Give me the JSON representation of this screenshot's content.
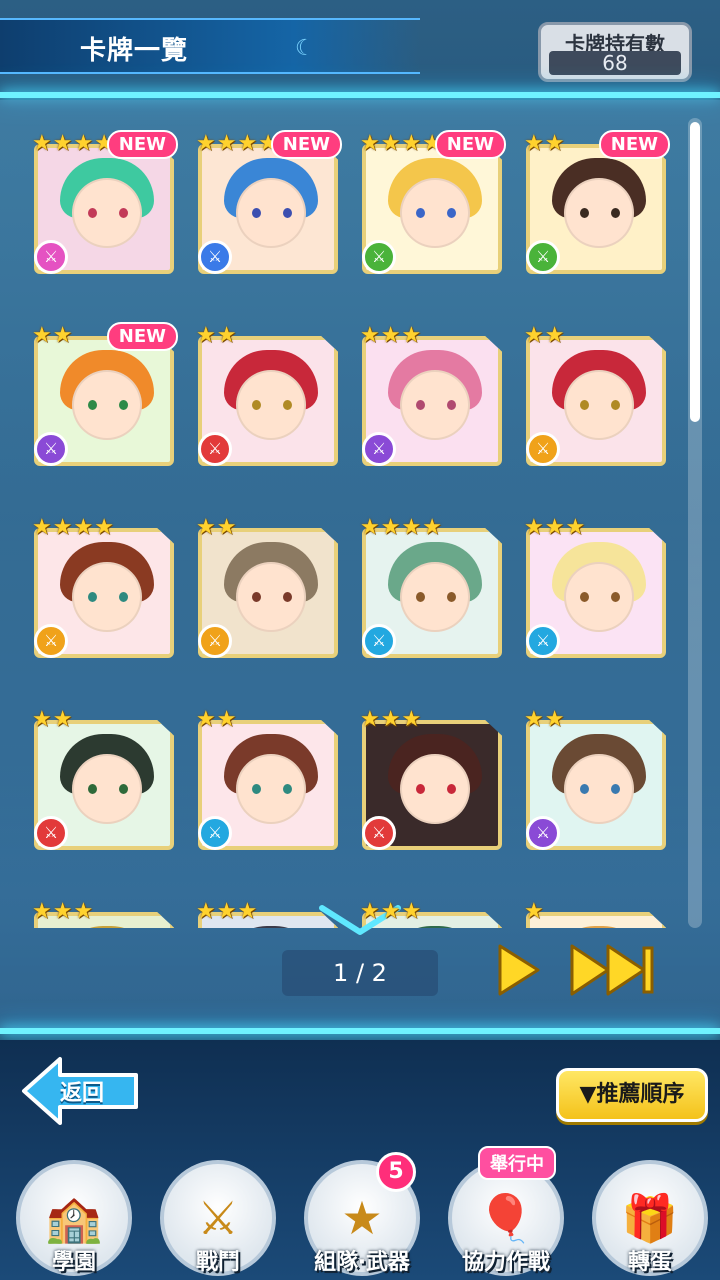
{
  "header": {
    "title": "卡牌一覽",
    "owned_label": "卡牌持有數",
    "owned_value": "68"
  },
  "cards": [
    {
      "stars": 4,
      "new": true,
      "type": "pink",
      "hair": "#3ec9a0",
      "bg": "#f5d7e6",
      "eye": "#c23a58"
    },
    {
      "stars": 4,
      "new": true,
      "type": "blue",
      "hair": "#3a86d6",
      "bg": "#fde6d3",
      "eye": "#3c4fb0"
    },
    {
      "stars": 4,
      "new": true,
      "type": "green",
      "hair": "#f4c64b",
      "bg": "#fff7d8",
      "eye": "#3b66c8"
    },
    {
      "stars": 2,
      "new": true,
      "type": "green",
      "hair": "#4a2e24",
      "bg": "#fff1c8",
      "eye": "#3a2a20"
    },
    {
      "stars": 2,
      "new": true,
      "type": "purple",
      "hair": "#f08a2a",
      "bg": "#e8f8d8",
      "eye": "#2e8a48"
    },
    {
      "stars": 2,
      "new": false,
      "type": "red",
      "hair": "#c8283a",
      "bg": "#fbe3ea",
      "eye": "#b08a24"
    },
    {
      "stars": 3,
      "new": false,
      "type": "purple",
      "hair": "#e47aa2",
      "bg": "#fbe0f0",
      "eye": "#b04a70"
    },
    {
      "stars": 2,
      "new": false,
      "type": "orange",
      "hair": "#c8283a",
      "bg": "#fbe3ea",
      "eye": "#b08a24"
    },
    {
      "stars": 4,
      "new": false,
      "type": "orange",
      "hair": "#8a3a22",
      "bg": "#fde6e8",
      "eye": "#2e8a80"
    },
    {
      "stars": 2,
      "new": false,
      "type": "orange",
      "hair": "#8c7a62",
      "bg": "#f1e3cc",
      "eye": "#7a3a2a"
    },
    {
      "stars": 4,
      "new": false,
      "type": "cyan",
      "hair": "#6aa88a",
      "bg": "#e6f3ef",
      "eye": "#8a5a2a"
    },
    {
      "stars": 3,
      "new": false,
      "type": "cyan",
      "hair": "#f6e49a",
      "bg": "#fbe3f4",
      "eye": "#8a5a2a"
    },
    {
      "stars": 2,
      "new": false,
      "type": "red",
      "hair": "#2c3a30",
      "bg": "#e6f6e6",
      "eye": "#2e6a3a"
    },
    {
      "stars": 2,
      "new": false,
      "type": "cyan",
      "hair": "#7a3a2a",
      "bg": "#fde6ea",
      "eye": "#2e8a80"
    },
    {
      "stars": 3,
      "new": false,
      "type": "red",
      "hair": "#4a2420",
      "bg": "#3a2a2a",
      "eye": "#c8283a"
    },
    {
      "stars": 2,
      "new": false,
      "type": "purple",
      "hair": "#6a4a34",
      "bg": "#e0f5f1",
      "eye": "#3a7ab0"
    },
    {
      "stars": 3,
      "new": false,
      "type": "orange",
      "hair": "#c8a23a",
      "bg": "#e8f0d0",
      "eye": "#333"
    },
    {
      "stars": 3,
      "new": false,
      "type": "blue",
      "hair": "#3a3a4a",
      "bg": "#dfe6f0",
      "eye": "#333"
    },
    {
      "stars": 3,
      "new": false,
      "type": "green",
      "hair": "#2e6a4a",
      "bg": "#e3f0e4",
      "eye": "#333"
    },
    {
      "stars": 1,
      "new": false,
      "type": "orange",
      "hair": "#e0a24a",
      "bg": "#fdf0d8",
      "eye": "#333"
    }
  ],
  "new_label": "NEW",
  "pager": {
    "text": "1 / 2"
  },
  "controls": {
    "back_label": "返回",
    "sort_label": "▼推薦順序"
  },
  "nav": [
    {
      "label": "學園"
    },
    {
      "label": "戰鬥"
    },
    {
      "label": "組隊‧武器",
      "badge": "5"
    },
    {
      "label": "協力作戰",
      "tag": "舉行中"
    },
    {
      "label": "轉蛋"
    }
  ]
}
